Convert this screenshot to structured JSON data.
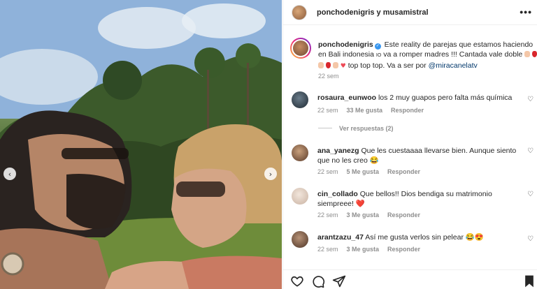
{
  "header": {
    "title": "ponchodenigris y musamistral",
    "more_label": "•••"
  },
  "caption": {
    "username": "ponchodenigris",
    "text_part1": "Este reality de parejas que estamos haciendo en Bali indonesia ",
    "text_io": "IO",
    "text_part2": " va a romper madres !!! Cantada vale doble ",
    "text_part3": " top top top. Va a ser por ",
    "mention": "@miracanelatv",
    "time": "22 sem"
  },
  "comments": [
    {
      "username": "rosaura_eunwoo",
      "text": "los 2 muy guapos pero falta más química",
      "time": "22 sem",
      "likes": "33 Me gusta",
      "reply": "Responder"
    },
    {
      "username": "ana_yanezg",
      "text": "Que les cuestaaaa llevarse bien. Aunque siento que no les creo 😂",
      "time": "22 sem",
      "likes": "5 Me gusta",
      "reply": "Responder"
    },
    {
      "username": "cin_collado",
      "text": "Que bellos!! Dios bendiga su matrimonio siempreee! ❤️",
      "time": "22 sem",
      "likes": "3 Me gusta",
      "reply": "Responder"
    },
    {
      "username": "arantzazu_47",
      "text": "Así me gusta verlos sin pelear 😂😍",
      "time": "22 sem",
      "likes": "3 Me gusta",
      "reply": "Responder"
    }
  ],
  "replies_label": "Ver respuestas (2)",
  "icons": {
    "prev": "chevron-left-icon",
    "next": "chevron-right-icon",
    "like": "heart-icon",
    "comment": "comment-icon",
    "share": "share-icon",
    "save": "bookmark-icon"
  },
  "colors": {
    "text": "#262626",
    "muted": "#8e8e8e",
    "link": "#00376b",
    "verified": "#3897f0",
    "heart": "#ed4956"
  }
}
